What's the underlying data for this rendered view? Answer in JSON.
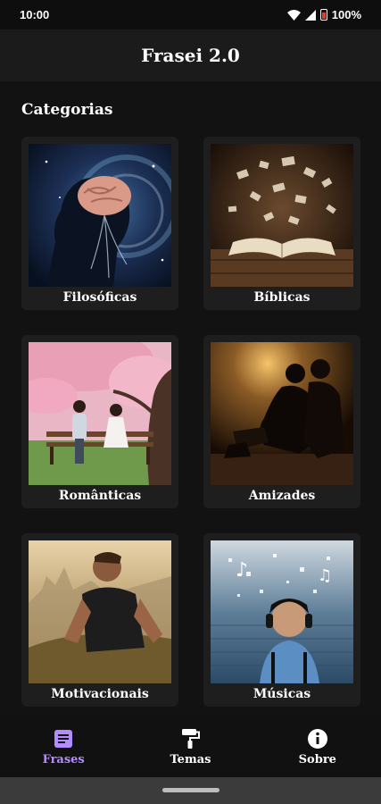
{
  "status": {
    "time": "10:00",
    "battery": "100%"
  },
  "app": {
    "title": "Frasei 2.0"
  },
  "section": {
    "title": "Categorias"
  },
  "categories": [
    {
      "label": "Filosóficas"
    },
    {
      "label": "Bíblicas"
    },
    {
      "label": "Românticas"
    },
    {
      "label": "Amizades"
    },
    {
      "label": "Motivacionais"
    },
    {
      "label": "Músicas"
    }
  ],
  "nav": [
    {
      "label": "Frases",
      "icon": "notes-icon",
      "active": true
    },
    {
      "label": "Temas",
      "icon": "paint-roller-icon",
      "active": false
    },
    {
      "label": "Sobre",
      "icon": "info-icon",
      "active": false
    }
  ],
  "colors": {
    "accent": "#b58cff",
    "background": "#121212",
    "card": "#1e1e1e"
  }
}
